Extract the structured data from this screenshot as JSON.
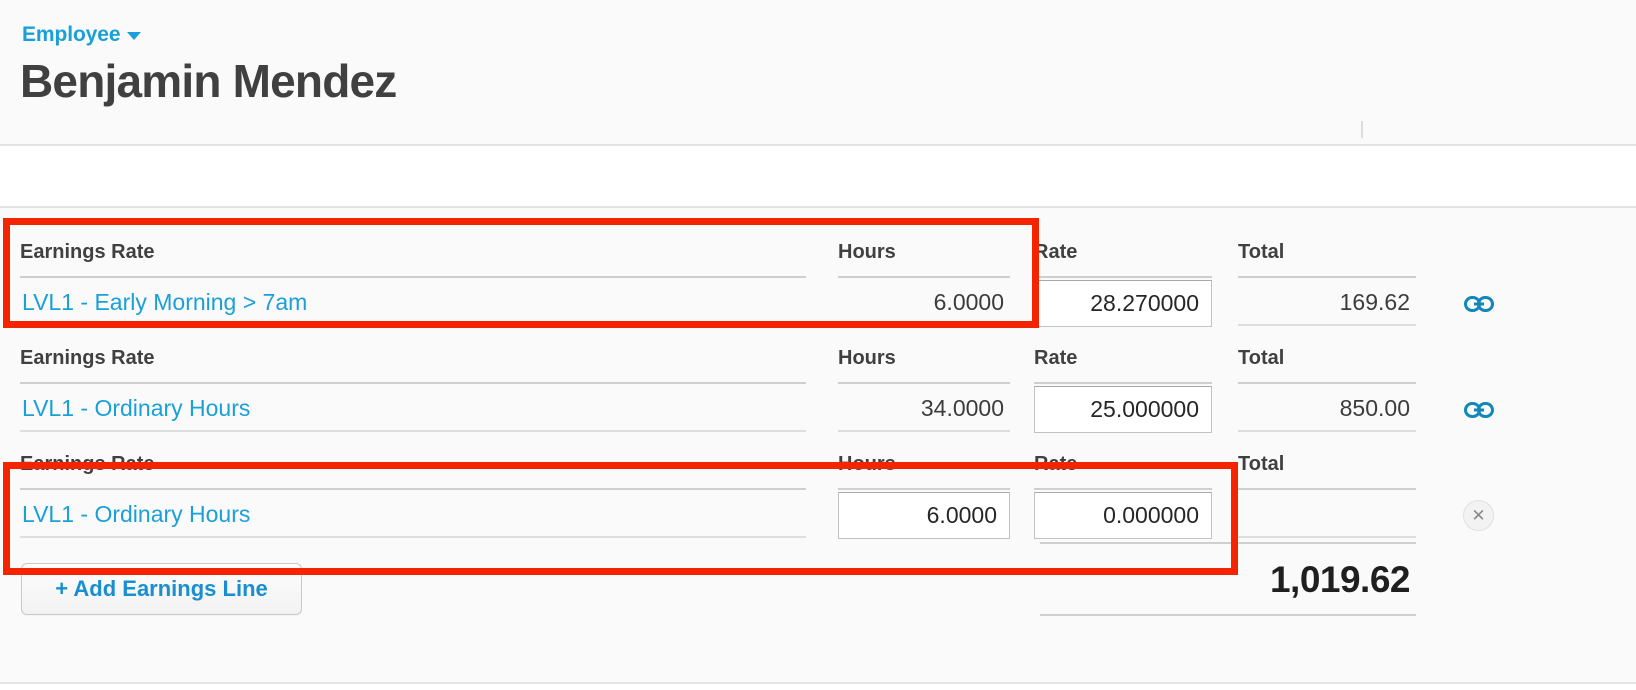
{
  "header": {
    "breadcrumb_label": "Employee",
    "breadcrumb_icon": "chevron-down-icon",
    "title": "Benjamin Mendez"
  },
  "table": {
    "columns": {
      "earnings_rate": "Earnings Rate",
      "hours": "Hours",
      "rate": "Rate",
      "total": "Total"
    },
    "rows": [
      {
        "earnings_rate": "LVL1 - Early Morning > 7am",
        "hours": "6.0000",
        "rate": "28.270000",
        "total": "169.62",
        "action_icon": "link-icon"
      },
      {
        "earnings_rate": "LVL1 - Ordinary Hours",
        "hours": "34.0000",
        "rate": "25.000000",
        "total": "850.00",
        "action_icon": "link-icon"
      },
      {
        "earnings_rate": "LVL1 - Ordinary Hours",
        "hours": "6.0000",
        "rate": "0.000000",
        "total": "",
        "action_icon": "remove-icon"
      }
    ]
  },
  "footer": {
    "add_line_label": "+ Add Earnings Line",
    "grand_total": "1,019.62"
  },
  "colors": {
    "link_blue": "#1aa0d8",
    "annotation_red": "#f42400",
    "text_dark": "#404040",
    "panel_bg": "#fafafa"
  }
}
